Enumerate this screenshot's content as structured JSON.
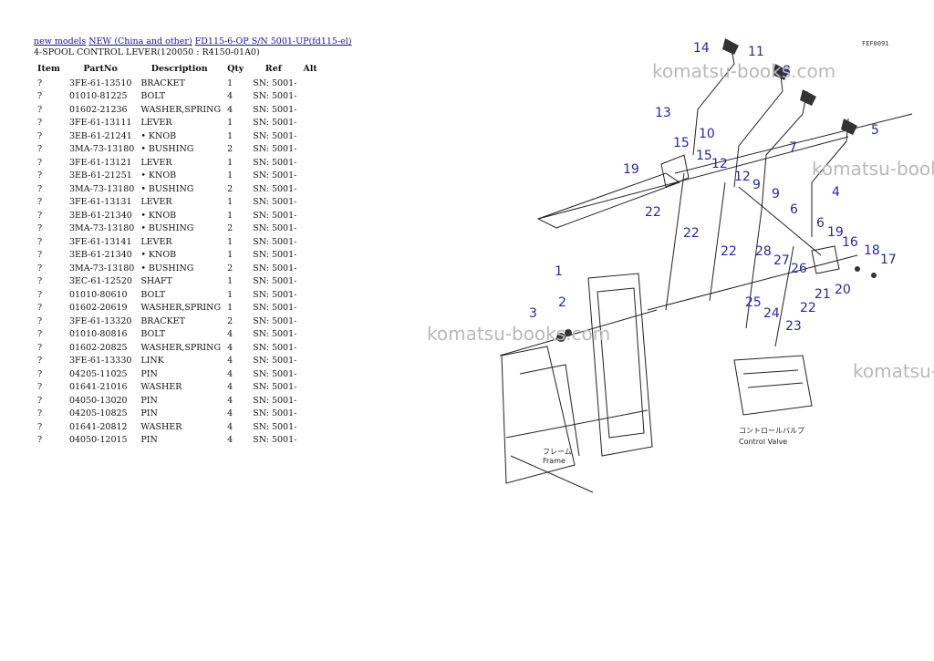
{
  "breadcrumb": {
    "links": [
      "new models",
      "NEW (China and other)",
      "FD115-6-OP S/N 5001-UP(fd115-el)"
    ]
  },
  "page_title": "4-SPOOL CONTROL LEVER(120050 : R4150-01A0)",
  "table": {
    "headers": [
      "Item",
      "PartNo",
      "Description",
      "Qty",
      "Ref",
      "Alt"
    ],
    "rows": [
      [
        "?",
        "3FE-61-13510",
        "BRACKET",
        "1",
        "SN: 5001-",
        ""
      ],
      [
        "?",
        "01010-81225",
        "BOLT",
        "4",
        "SN: 5001-",
        ""
      ],
      [
        "?",
        "01602-21236",
        "WASHER,SPRING",
        "4",
        "SN: 5001-",
        ""
      ],
      [
        "?",
        "3FE-61-13111",
        "LEVER",
        "1",
        "SN: 5001-",
        ""
      ],
      [
        "?",
        "3EB-61-21241",
        "• KNOB",
        "1",
        "SN: 5001-",
        ""
      ],
      [
        "?",
        "3MA-73-13180",
        "• BUSHING",
        "2",
        "SN: 5001-",
        ""
      ],
      [
        "?",
        "3FE-61-13121",
        "LEVER",
        "1",
        "SN: 5001-",
        ""
      ],
      [
        "?",
        "3EB-61-21251",
        "• KNOB",
        "1",
        "SN: 5001-",
        ""
      ],
      [
        "?",
        "3MA-73-13180",
        "• BUSHING",
        "2",
        "SN: 5001-",
        ""
      ],
      [
        "?",
        "3FE-61-13131",
        "LEVER",
        "1",
        "SN: 5001-",
        ""
      ],
      [
        "?",
        "3EB-61-21340",
        "• KNOB",
        "1",
        "SN: 5001-",
        ""
      ],
      [
        "?",
        "3MA-73-13180",
        "• BUSHING",
        "2",
        "SN: 5001-",
        ""
      ],
      [
        "?",
        "3FE-61-13141",
        "LEVER",
        "1",
        "SN: 5001-",
        ""
      ],
      [
        "?",
        "3EB-61-21340",
        "• KNOB",
        "1",
        "SN: 5001-",
        ""
      ],
      [
        "?",
        "3MA-73-13180",
        "• BUSHING",
        "2",
        "SN: 5001-",
        ""
      ],
      [
        "?",
        "3EC-61-12520",
        "SHAFT",
        "1",
        "SN: 5001-",
        ""
      ],
      [
        "?",
        "01010-80610",
        "BOLT",
        "1",
        "SN: 5001-",
        ""
      ],
      [
        "?",
        "01602-20619",
        "WASHER,SPRING",
        "1",
        "SN: 5001-",
        ""
      ],
      [
        "?",
        "3FE-61-13320",
        "BRACKET",
        "2",
        "SN: 5001-",
        ""
      ],
      [
        "?",
        "01010-80816",
        "BOLT",
        "4",
        "SN: 5001-",
        ""
      ],
      [
        "?",
        "01602-20825",
        "WASHER,SPRING",
        "4",
        "SN: 5001-",
        ""
      ],
      [
        "?",
        "3FE-61-13330",
        "LINK",
        "4",
        "SN: 5001-",
        ""
      ],
      [
        "?",
        "04205-11025",
        "PIN",
        "4",
        "SN: 5001-",
        ""
      ],
      [
        "?",
        "01641-21016",
        "WASHER",
        "4",
        "SN: 5001-",
        ""
      ],
      [
        "?",
        "04050-13020",
        "PIN",
        "4",
        "SN: 5001-",
        ""
      ],
      [
        "?",
        "04205-10825",
        "PIN",
        "4",
        "SN: 5001-",
        ""
      ],
      [
        "?",
        "01641-20812",
        "WASHER",
        "4",
        "SN: 5001-",
        ""
      ],
      [
        "?",
        "04050-12015",
        "PIN",
        "4",
        "SN: 5001-",
        ""
      ]
    ]
  },
  "diagram": {
    "code": "FEF0091",
    "watermark": "komatsu-books.com",
    "valve_jp": "コントロールバルブ",
    "valve_en": "Control Valve",
    "frame_jp": "フレーム",
    "frame_en": "Frame",
    "callouts": [
      "14",
      "11",
      "8",
      "13",
      "10",
      "7",
      "5",
      "15",
      "15",
      "12",
      "12",
      "9",
      "9",
      "6",
      "6",
      "4",
      "19",
      "19",
      "22",
      "22",
      "22",
      "28",
      "27",
      "26",
      "16",
      "18",
      "17",
      "1",
      "3",
      "2",
      "25",
      "24",
      "23",
      "22",
      "21",
      "20"
    ]
  }
}
